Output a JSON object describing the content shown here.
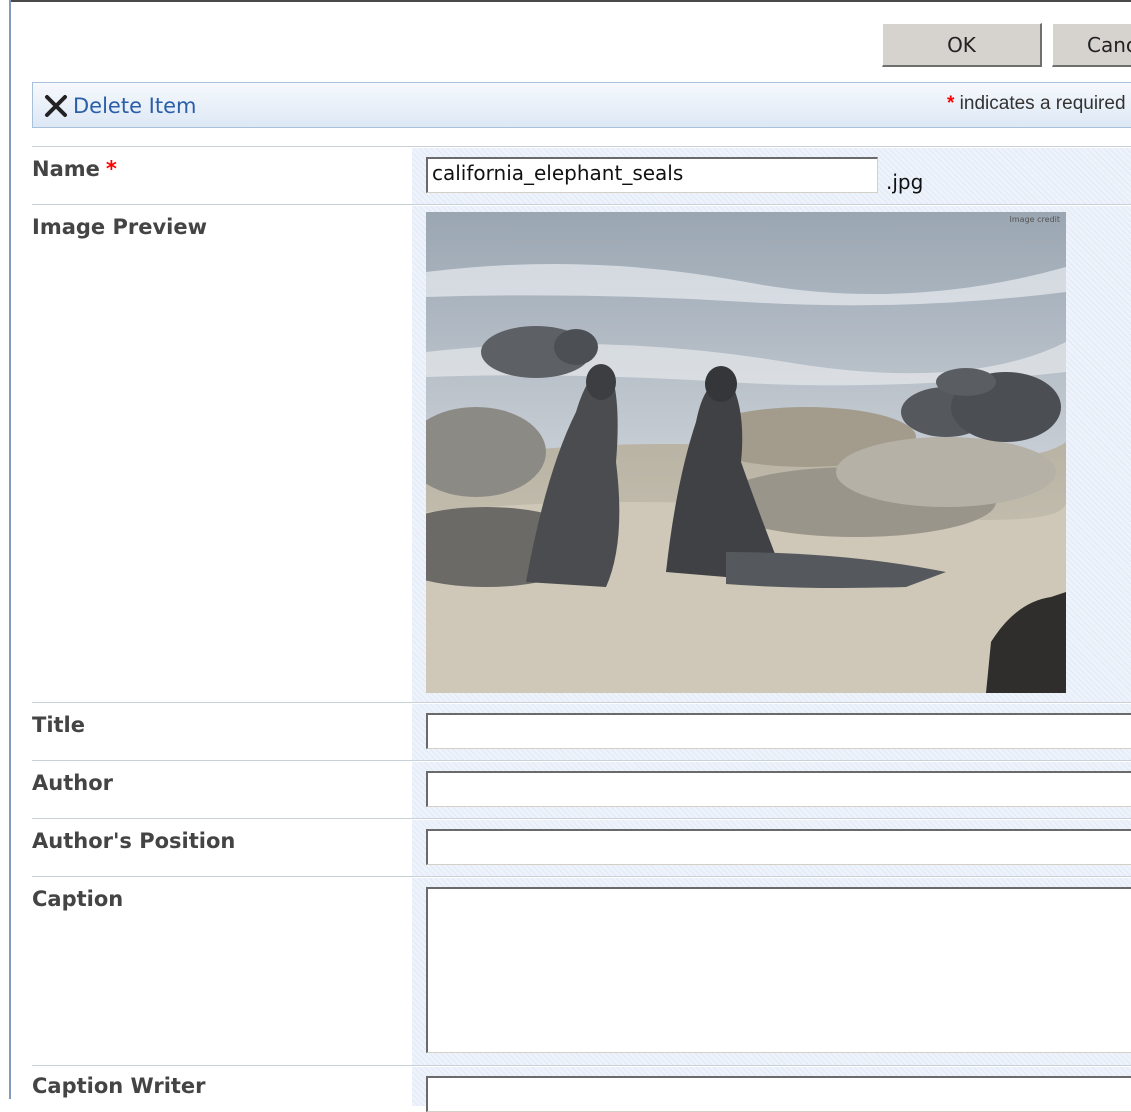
{
  "buttons": {
    "ok": "OK",
    "cancel": "Cancel"
  },
  "toolbar": {
    "delete_item": "Delete Item",
    "required_star": "*",
    "required_note": " indicates a required field"
  },
  "form": {
    "name": {
      "label": "Name",
      "required_marker": "*",
      "value": "california_elephant_seals",
      "extension": ".jpg"
    },
    "image_preview": {
      "label": "Image Preview",
      "credit": "Image credit"
    },
    "title": {
      "label": "Title",
      "value": ""
    },
    "author": {
      "label": "Author",
      "value": ""
    },
    "authors_position": {
      "label": "Author's Position",
      "value": ""
    },
    "caption": {
      "label": "Caption",
      "value": ""
    },
    "caption_writer": {
      "label": "Caption Writer",
      "value": ""
    }
  },
  "colors": {
    "link": "#2b5ea8",
    "required": "#ff0000",
    "field_bg": "#eef3fb"
  },
  "icons": {
    "delete": "x-icon"
  }
}
